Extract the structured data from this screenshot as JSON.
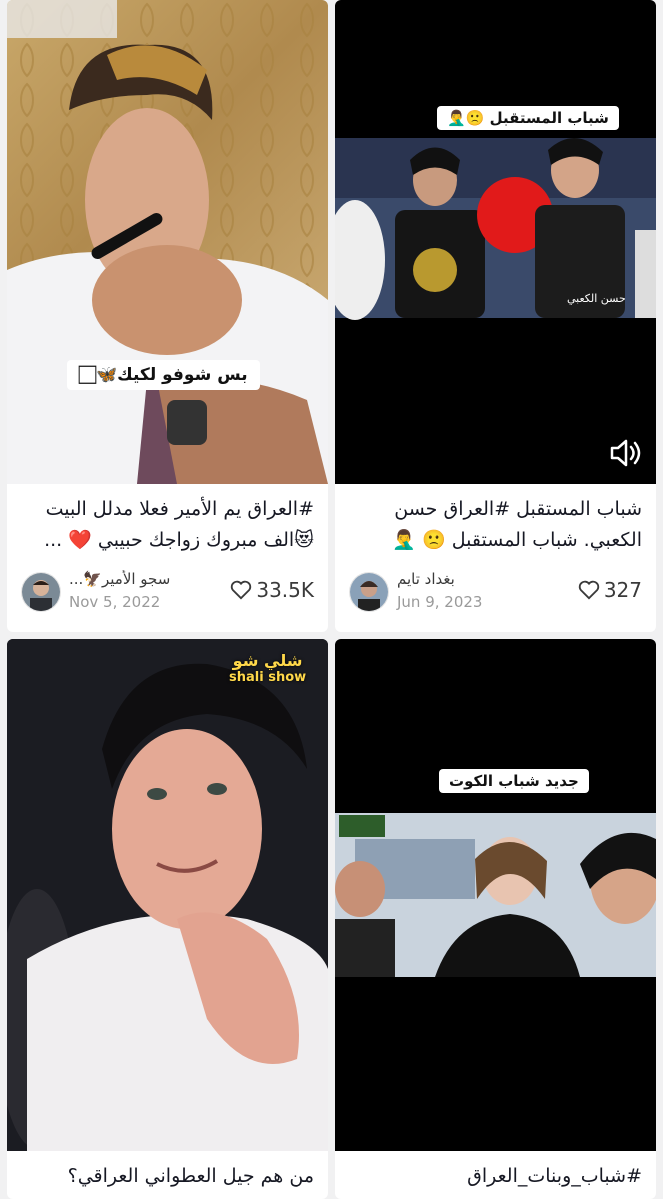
{
  "cards": [
    {
      "caption": "#العراق يم الأمير فعلا مدلل البيت 😻الف مبروك زواجك حبيبي ❤️ ...",
      "sticker": "بس شوفو لكيك🦋🏻",
      "author": "سجو الأمير🦅...",
      "date": "Nov 5, 2022",
      "likes": "33.5K"
    },
    {
      "caption": "شباب المستقبل #العراق حسن الكعبي. شباب المستقبل 🙁 🤦‍♂️",
      "sticker": "شباب المستقبل 🙁🤦‍♂️",
      "watermark": "حسن الكعبي",
      "author": "بغداد تايم",
      "date": "Jun 9, 2023",
      "likes": "327"
    },
    {
      "caption": "من هم جيل العطواني العراقي؟",
      "logo": "شلي شو",
      "logo_sub": "shali show"
    },
    {
      "caption": "#شباب_وبنات_العراق",
      "sticker": "جديد شباب الكوت"
    }
  ],
  "icons": {
    "heart": "heart-icon",
    "sound": "speaker-icon"
  }
}
